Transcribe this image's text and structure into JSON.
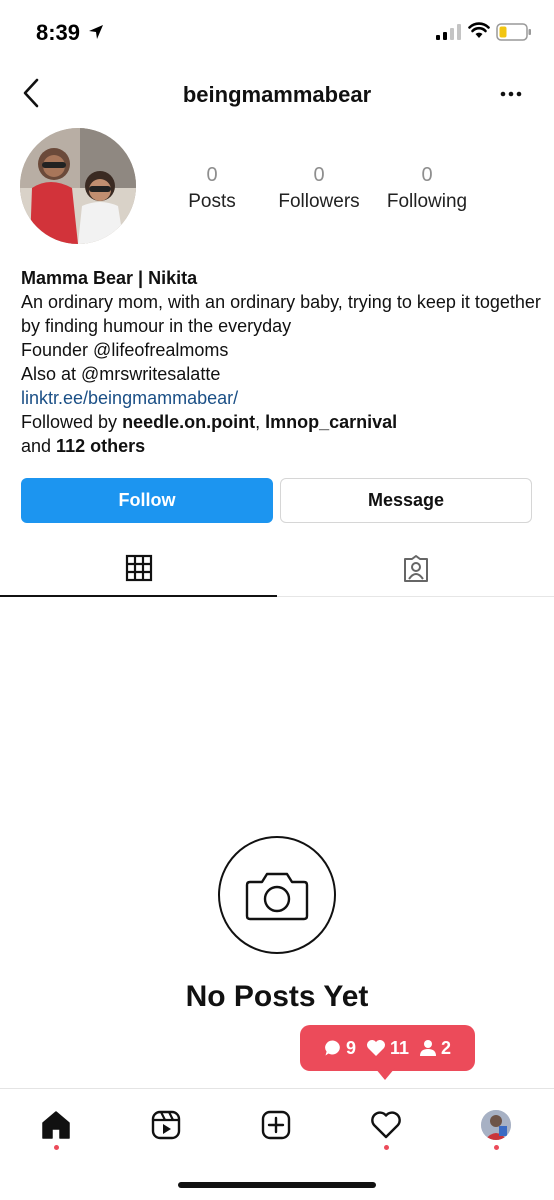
{
  "status_bar": {
    "time": "8:39"
  },
  "header": {
    "username": "beingmammabear"
  },
  "profile": {
    "stats": [
      {
        "value": "0",
        "label": "Posts"
      },
      {
        "value": "0",
        "label": "Followers"
      },
      {
        "value": "0",
        "label": "Following"
      }
    ],
    "bio": {
      "name": "Mamma Bear | Nikita",
      "line1": "An ordinary mom, with an ordinary baby, trying to keep it together by finding humour in the everyday",
      "line2": "Founder @lifeofrealmoms",
      "line3": "Also at @mrswritesalatte",
      "link": "linktr.ee/beingmammabear/",
      "followed_by_prefix": "Followed by ",
      "followed_by_user1": "needle.on.point",
      "followed_by_sep": ", ",
      "followed_by_user2": "lmnop_carnival",
      "followed_by_and": "and ",
      "followed_by_others": "112 others"
    }
  },
  "actions": {
    "follow_label": "Follow",
    "message_label": "Message"
  },
  "empty_state": {
    "title": "No Posts Yet"
  },
  "notification": {
    "comments": "9",
    "likes": "11",
    "follows": "2"
  },
  "colors": {
    "primary": "#1c95f0",
    "notification": "#ec4b5a",
    "link": "#1a4f86"
  }
}
